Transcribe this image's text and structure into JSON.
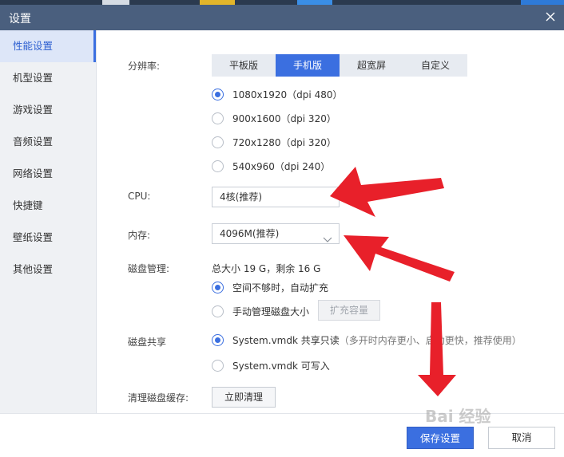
{
  "window": {
    "title": "设置"
  },
  "sidebar": {
    "items": [
      {
        "label": "性能设置",
        "active": true
      },
      {
        "label": "机型设置"
      },
      {
        "label": "游戏设置"
      },
      {
        "label": "音频设置"
      },
      {
        "label": "网络设置"
      },
      {
        "label": "快捷键"
      },
      {
        "label": "壁纸设置"
      },
      {
        "label": "其他设置"
      }
    ]
  },
  "resolution": {
    "label": "分辨率:",
    "tabs": [
      "平板版",
      "手机版",
      "超宽屏",
      "自定义"
    ],
    "selected_tab": "手机版",
    "options": [
      "1080x1920（dpi 480）",
      "900x1600（dpi 320）",
      "720x1280（dpi 320）",
      "540x960（dpi 240）"
    ],
    "selected_option": "1080x1920（dpi 480）"
  },
  "cpu": {
    "label": "CPU:",
    "value": "4核(推荐)"
  },
  "memory": {
    "label": "内存:",
    "value": "4096M(推荐)"
  },
  "disk": {
    "label": "磁盘管理:",
    "summary": "总大小 19 G，剩余 16 G",
    "options": [
      "空间不够时，自动扩充",
      "手动管理磁盘大小"
    ],
    "expand_button": "扩充容量"
  },
  "share": {
    "label": "磁盘共享",
    "option1": "System.vmdk 共享只读",
    "option1_hint": "（多开时内存更小、启动更快，推荐使用）",
    "option2": "System.vmdk 可写入"
  },
  "cache": {
    "label": "清理磁盘缓存:",
    "button": "立即清理"
  },
  "footer": {
    "save": "保存设置",
    "cancel": "取消"
  },
  "watermark": "Bai 经验",
  "colors": {
    "accent": "#3b6fe0",
    "titlebar": "#4a5f7e",
    "arrow": "#e8202a"
  }
}
